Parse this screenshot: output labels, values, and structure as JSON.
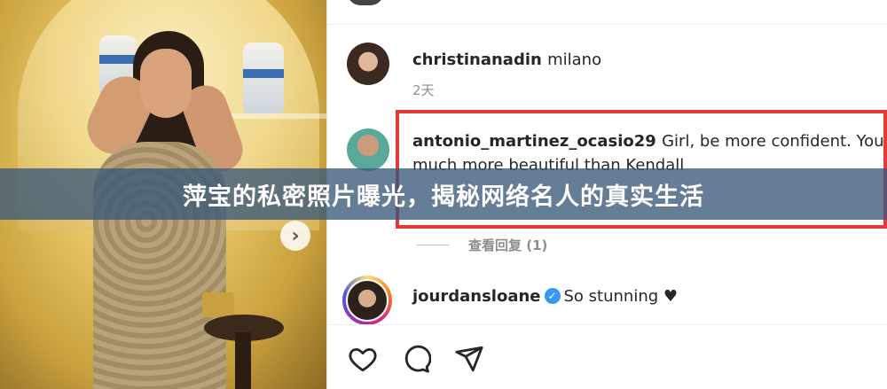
{
  "banner": {
    "title": "萍宝的私密照片曝光，揭秘网络名人的真实生活"
  },
  "photo": {
    "next_glyph": "›"
  },
  "comments": [
    {
      "username": "christinanadin",
      "text": "milano",
      "time": "2天"
    },
    {
      "username": "antonio_martinez_ocasio29",
      "text": "Girl, be more confident. You're",
      "text_line2": "much more beautiful than Kendall",
      "view_replies": "查看回复 (1)"
    },
    {
      "username": "jourdansloane",
      "verified": true,
      "text": "So stunning ♥"
    }
  ],
  "icons": {
    "like": "heart-icon",
    "comment": "comment-icon",
    "share": "share-icon",
    "verified": "verified-badge-icon"
  },
  "colors": {
    "highlight": "#e53935",
    "verified": "#3897f0",
    "banner": "#3a5878"
  }
}
